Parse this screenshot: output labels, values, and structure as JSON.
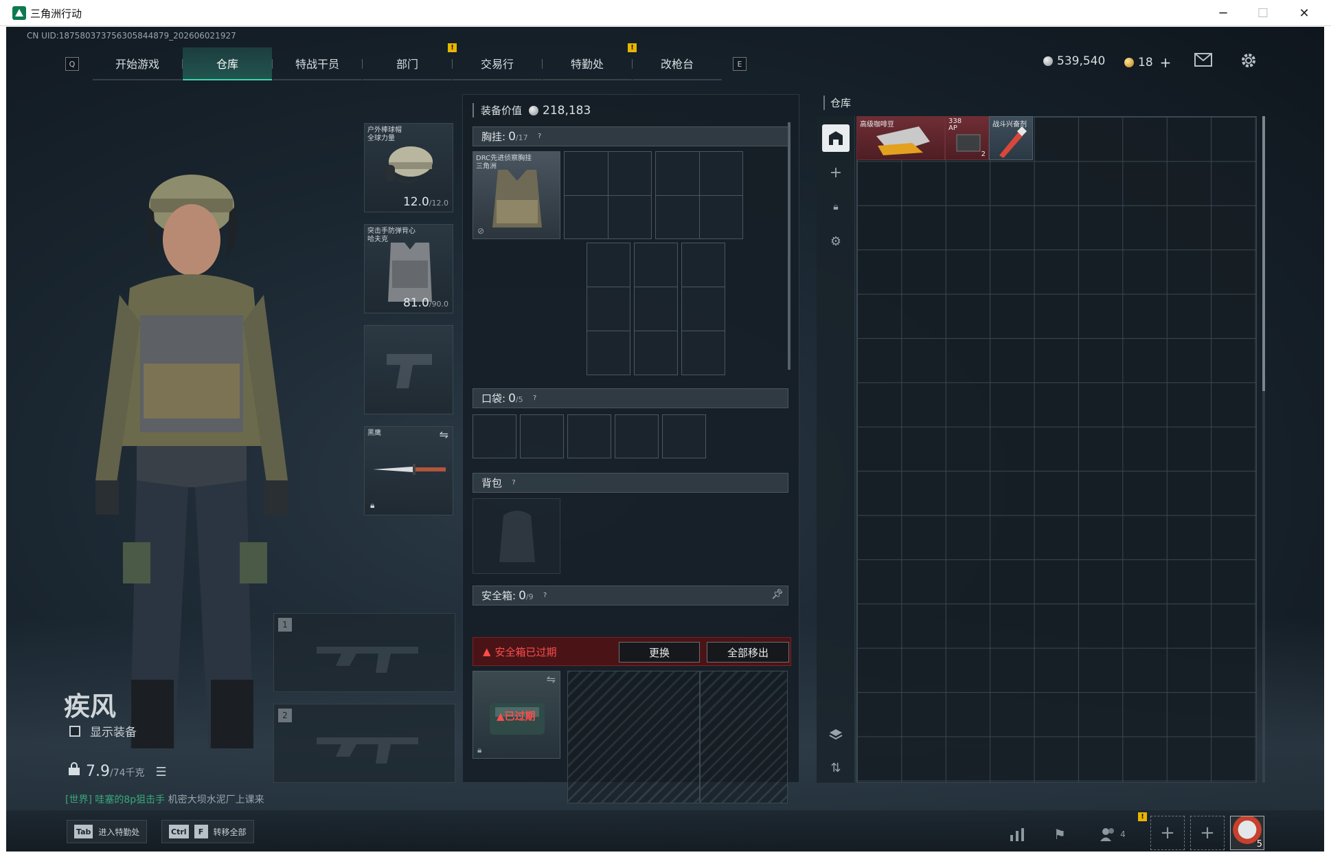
{
  "window": {
    "title": "三角洲行动",
    "minimize": "─",
    "maximize": "☐",
    "close": "✕"
  },
  "uid": "CN UID:18758037375630584487​9_202606021927",
  "nav": {
    "left_key": "Q",
    "right_key": "E",
    "tabs": [
      "开始游戏",
      "仓库",
      "特战干员",
      "部门",
      "交易行",
      "特勤处",
      "改枪台"
    ],
    "active_tab": "仓库",
    "badge": "!"
  },
  "currency": {
    "silver": "539,540",
    "gold": "18",
    "add": "+"
  },
  "icons": {
    "mail": "mail-icon",
    "settings": "gear-icon"
  },
  "character": {
    "name": "疾风",
    "show_equipment_label": "显示装备",
    "weight_value": "7.9",
    "weight_max": "/74千克"
  },
  "chat": {
    "channel": "[世界]",
    "sender": "哇塞的8p狙击手",
    "message": " 机密大坝水泥厂上课来"
  },
  "gear": {
    "helmet_label": "户外棒球帽\n全球力量",
    "helmet_value": "12.0",
    "helmet_max": "/12.0",
    "armor_label": "突击手防弹背心\n哈夫克",
    "armor_value": "81.0",
    "armor_max": "/90.0",
    "melee_label": "黑鹰",
    "weapon_slot_1": "1",
    "weapon_slot_2": "2"
  },
  "loadout": {
    "equip_value_label": "装备价值",
    "equip_value": "218,183",
    "chest_label": "胸挂:",
    "chest_count": "0",
    "chest_max": "/17",
    "chest_item_label": "DRC先进侦察胸挂\n三角洲",
    "pocket_label": "口袋:",
    "pocket_count": "0",
    "pocket_max": "/5",
    "backpack_label": "背包",
    "safebox_label": "安全箱:",
    "safebox_count": "0",
    "safebox_max": "/9",
    "expired_warning": "安全箱已过期",
    "replace_button": "更换",
    "move_all_button": "全部移出",
    "expired_tag": "已过期",
    "help": "?"
  },
  "warehouse": {
    "title": "仓库",
    "items": [
      {
        "label": "高级咖啡豆",
        "qty": ""
      },
      {
        "label": "338\nAP",
        "qty": "2"
      },
      {
        "label": "战斗兴奋剂",
        "qty": ""
      }
    ]
  },
  "bottom": {
    "hint_tab_key": "Tab",
    "hint_tab_text": "进入特勤处",
    "hint_ctrl_key": "Ctrl",
    "hint_f_key": "F",
    "hint_transfer_text": "转移全部",
    "friends_count": "4",
    "level": "5",
    "plus": "+"
  }
}
